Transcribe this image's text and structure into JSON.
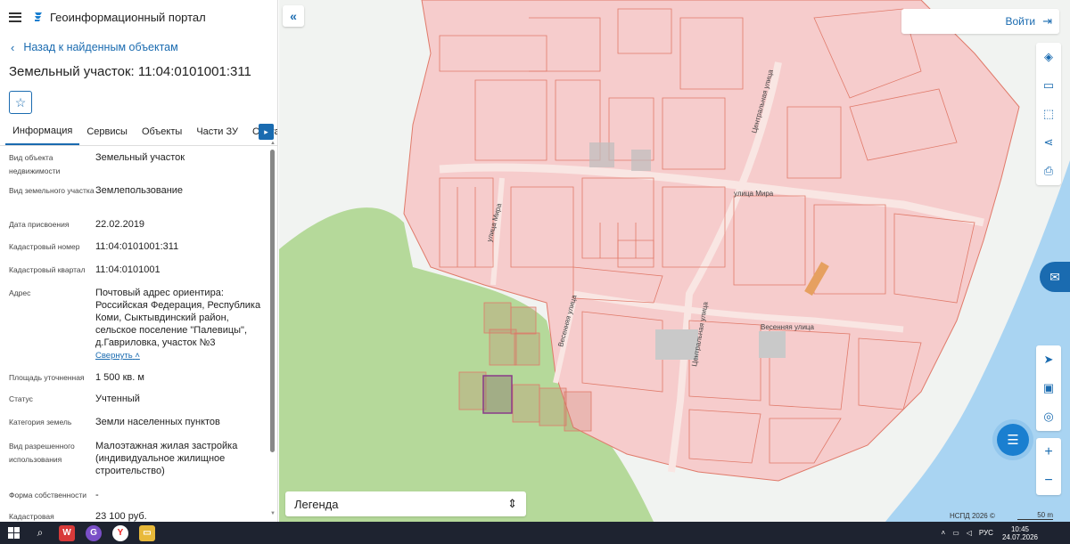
{
  "app": {
    "title": "Геоинформационный портал"
  },
  "panel": {
    "back_label": "Назад к найденным объектам",
    "parcel_title": "Земельный участок: 11:04:0101001:311",
    "tabs": [
      {
        "label": "Информация"
      },
      {
        "label": "Сервисы"
      },
      {
        "label": "Объекты"
      },
      {
        "label": "Части ЗУ"
      },
      {
        "label": "Состав"
      }
    ],
    "fields": [
      {
        "label": "Вид объекта недвижимости",
        "value": "Земельный участок"
      },
      {
        "label": "Вид земельного участка",
        "value": "Землепользование"
      },
      {
        "label": "Дата присвоения",
        "value": "22.02.2019"
      },
      {
        "label": "Кадастровый номер",
        "value": "11:04:0101001:311"
      },
      {
        "label": "Кадастровый квартал",
        "value": "11:04:0101001"
      },
      {
        "label": "Адрес",
        "value": "Почтовый адрес ориентира: Российская Федерация, Республика Коми, Сыктывдинский район, сельское поселение \"Палевицы\", д.Гавриловка, участок №3"
      },
      {
        "label": "Площадь уточненная",
        "value": "1 500 кв. м"
      },
      {
        "label": "Статус",
        "value": "Учтенный"
      },
      {
        "label": "Категория земель",
        "value": "Земли населенных пунктов"
      },
      {
        "label": "Вид разрешенного использования",
        "value": "Малоэтажная жилая застройка (индивидуальное жилищное строительство)"
      },
      {
        "label": "Форма собственности",
        "value": "-"
      },
      {
        "label": "Кадастровая",
        "value": "23 100 руб."
      }
    ],
    "collapse_label": "Свернуть"
  },
  "map": {
    "login_label": "Войти",
    "legend_label": "Легенда",
    "copyright": "НСПД 2026 ©",
    "scale_label": "50 m",
    "streets": [
      {
        "name": "улица Мира"
      },
      {
        "name": "Центральная улица"
      },
      {
        "name": "Весенняя улица"
      }
    ]
  },
  "taskbar": {
    "lang": "РУС",
    "time": "10:45",
    "date": "24.07.2026"
  },
  "colors": {
    "accent": "#1a6bb0",
    "parcel_fill": "#f6cccc",
    "parcel_stroke": "#e07a6a",
    "field_green": "#b5d99a",
    "river": "#a9d4f2"
  }
}
